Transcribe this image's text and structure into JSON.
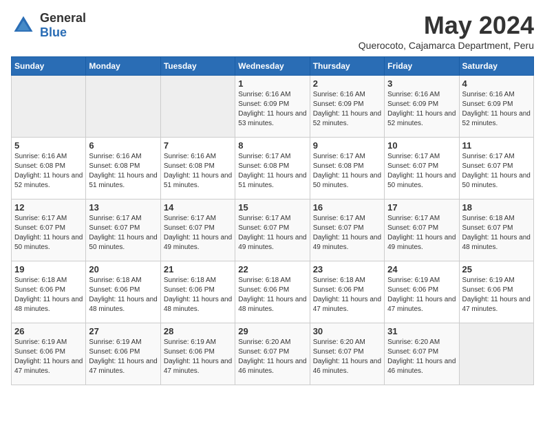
{
  "header": {
    "logo_general": "General",
    "logo_blue": "Blue",
    "month_title": "May 2024",
    "location": "Querocoto, Cajamarca Department, Peru"
  },
  "days_of_week": [
    "Sunday",
    "Monday",
    "Tuesday",
    "Wednesday",
    "Thursday",
    "Friday",
    "Saturday"
  ],
  "weeks": [
    [
      {
        "day": "",
        "info": ""
      },
      {
        "day": "",
        "info": ""
      },
      {
        "day": "",
        "info": ""
      },
      {
        "day": "1",
        "info": "Sunrise: 6:16 AM\nSunset: 6:09 PM\nDaylight: 11 hours and 53 minutes."
      },
      {
        "day": "2",
        "info": "Sunrise: 6:16 AM\nSunset: 6:09 PM\nDaylight: 11 hours and 52 minutes."
      },
      {
        "day": "3",
        "info": "Sunrise: 6:16 AM\nSunset: 6:09 PM\nDaylight: 11 hours and 52 minutes."
      },
      {
        "day": "4",
        "info": "Sunrise: 6:16 AM\nSunset: 6:09 PM\nDaylight: 11 hours and 52 minutes."
      }
    ],
    [
      {
        "day": "5",
        "info": "Sunrise: 6:16 AM\nSunset: 6:08 PM\nDaylight: 11 hours and 52 minutes."
      },
      {
        "day": "6",
        "info": "Sunrise: 6:16 AM\nSunset: 6:08 PM\nDaylight: 11 hours and 51 minutes."
      },
      {
        "day": "7",
        "info": "Sunrise: 6:16 AM\nSunset: 6:08 PM\nDaylight: 11 hours and 51 minutes."
      },
      {
        "day": "8",
        "info": "Sunrise: 6:17 AM\nSunset: 6:08 PM\nDaylight: 11 hours and 51 minutes."
      },
      {
        "day": "9",
        "info": "Sunrise: 6:17 AM\nSunset: 6:08 PM\nDaylight: 11 hours and 50 minutes."
      },
      {
        "day": "10",
        "info": "Sunrise: 6:17 AM\nSunset: 6:07 PM\nDaylight: 11 hours and 50 minutes."
      },
      {
        "day": "11",
        "info": "Sunrise: 6:17 AM\nSunset: 6:07 PM\nDaylight: 11 hours and 50 minutes."
      }
    ],
    [
      {
        "day": "12",
        "info": "Sunrise: 6:17 AM\nSunset: 6:07 PM\nDaylight: 11 hours and 50 minutes."
      },
      {
        "day": "13",
        "info": "Sunrise: 6:17 AM\nSunset: 6:07 PM\nDaylight: 11 hours and 50 minutes."
      },
      {
        "day": "14",
        "info": "Sunrise: 6:17 AM\nSunset: 6:07 PM\nDaylight: 11 hours and 49 minutes."
      },
      {
        "day": "15",
        "info": "Sunrise: 6:17 AM\nSunset: 6:07 PM\nDaylight: 11 hours and 49 minutes."
      },
      {
        "day": "16",
        "info": "Sunrise: 6:17 AM\nSunset: 6:07 PM\nDaylight: 11 hours and 49 minutes."
      },
      {
        "day": "17",
        "info": "Sunrise: 6:17 AM\nSunset: 6:07 PM\nDaylight: 11 hours and 49 minutes."
      },
      {
        "day": "18",
        "info": "Sunrise: 6:18 AM\nSunset: 6:07 PM\nDaylight: 11 hours and 48 minutes."
      }
    ],
    [
      {
        "day": "19",
        "info": "Sunrise: 6:18 AM\nSunset: 6:06 PM\nDaylight: 11 hours and 48 minutes."
      },
      {
        "day": "20",
        "info": "Sunrise: 6:18 AM\nSunset: 6:06 PM\nDaylight: 11 hours and 48 minutes."
      },
      {
        "day": "21",
        "info": "Sunrise: 6:18 AM\nSunset: 6:06 PM\nDaylight: 11 hours and 48 minutes."
      },
      {
        "day": "22",
        "info": "Sunrise: 6:18 AM\nSunset: 6:06 PM\nDaylight: 11 hours and 48 minutes."
      },
      {
        "day": "23",
        "info": "Sunrise: 6:18 AM\nSunset: 6:06 PM\nDaylight: 11 hours and 47 minutes."
      },
      {
        "day": "24",
        "info": "Sunrise: 6:19 AM\nSunset: 6:06 PM\nDaylight: 11 hours and 47 minutes."
      },
      {
        "day": "25",
        "info": "Sunrise: 6:19 AM\nSunset: 6:06 PM\nDaylight: 11 hours and 47 minutes."
      }
    ],
    [
      {
        "day": "26",
        "info": "Sunrise: 6:19 AM\nSunset: 6:06 PM\nDaylight: 11 hours and 47 minutes."
      },
      {
        "day": "27",
        "info": "Sunrise: 6:19 AM\nSunset: 6:06 PM\nDaylight: 11 hours and 47 minutes."
      },
      {
        "day": "28",
        "info": "Sunrise: 6:19 AM\nSunset: 6:06 PM\nDaylight: 11 hours and 47 minutes."
      },
      {
        "day": "29",
        "info": "Sunrise: 6:20 AM\nSunset: 6:07 PM\nDaylight: 11 hours and 46 minutes."
      },
      {
        "day": "30",
        "info": "Sunrise: 6:20 AM\nSunset: 6:07 PM\nDaylight: 11 hours and 46 minutes."
      },
      {
        "day": "31",
        "info": "Sunrise: 6:20 AM\nSunset: 6:07 PM\nDaylight: 11 hours and 46 minutes."
      },
      {
        "day": "",
        "info": ""
      }
    ]
  ]
}
